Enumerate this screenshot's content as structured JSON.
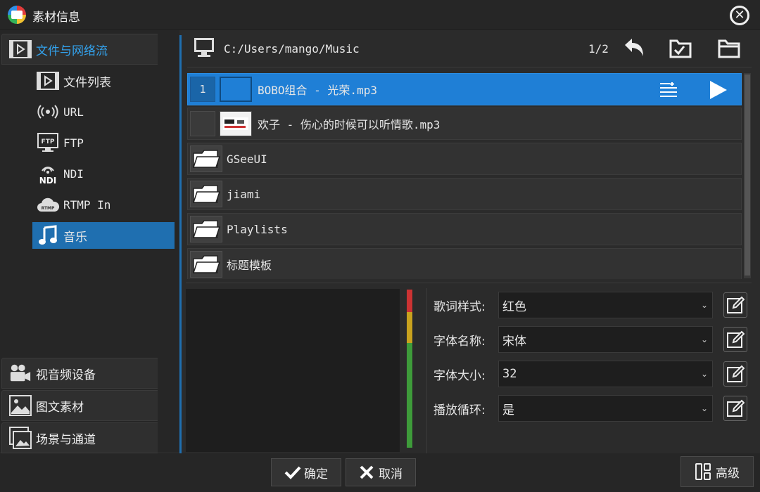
{
  "window": {
    "title": "素材信息"
  },
  "left_tabs": {
    "file_network": "文件与网络流",
    "av_devices": "视音频设备",
    "graphics": "图文素材",
    "scenes": "场景与通道"
  },
  "sub_items": {
    "file_list": "文件列表",
    "url": "URL",
    "ftp": "FTP",
    "ndi": "NDI",
    "rtmp": "RTMP In",
    "music": "音乐"
  },
  "path_bar": {
    "path": "C:/Users/mango/Music",
    "page": "1/2"
  },
  "files": [
    {
      "index": "1",
      "name": "BOBO组合 - 光荣.mp3"
    },
    {
      "index": "",
      "name": "欢子 - 伤心的时候可以听情歌.mp3"
    },
    {
      "name": "GSeeUI"
    },
    {
      "name": "jiami"
    },
    {
      "name": "Playlists"
    },
    {
      "name": "标题模板"
    }
  ],
  "properties": {
    "lyric_style": {
      "label": "歌词样式:",
      "value": "红色"
    },
    "font_name": {
      "label": "字体名称:",
      "value": "宋体"
    },
    "font_size": {
      "label": "字体大小:",
      "value": "32"
    },
    "loop": {
      "label": "播放循环:",
      "value": "是"
    }
  },
  "footer": {
    "confirm": "确定",
    "cancel": "取消",
    "advanced": "高级"
  },
  "colors": {
    "accent": "#1f7fd6",
    "selected_text": "#33a3ee",
    "background": "#2b2b2b"
  }
}
